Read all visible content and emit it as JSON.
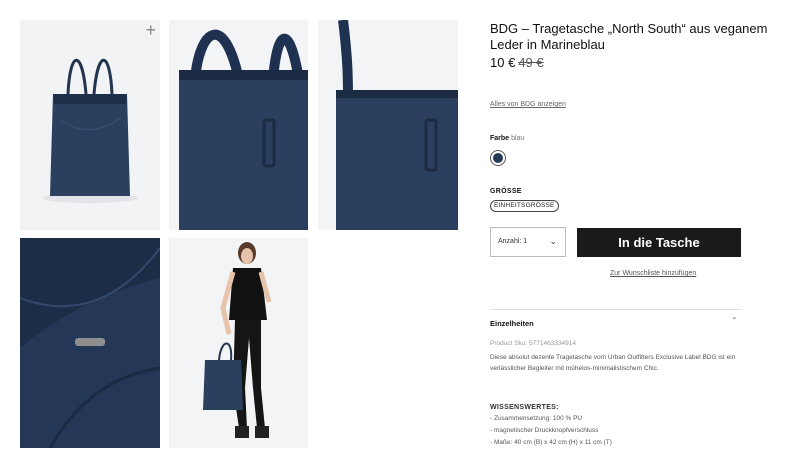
{
  "gallery": {
    "zoom_icon": "+",
    "images": [
      {
        "alt": "tote-bag-front"
      },
      {
        "alt": "tote-bag-handle-closeup"
      },
      {
        "alt": "tote-bag-side-closeup"
      },
      {
        "alt": "tote-bag-interior-closeup"
      },
      {
        "alt": "model-carrying-tote"
      }
    ]
  },
  "product": {
    "title": "BDG – Tragetasche „North South“ aus veganem Leder in Marineblau",
    "price": "10 €",
    "old_price": "49 €",
    "brand_link": "Alles von BDG anzeigen",
    "color_label": "Farbe",
    "color_value": "blau",
    "swatch_color": "#263a58",
    "size_label": "GRÖSSE",
    "size_option": "EINHEITSGRÖSSE",
    "qty_label": "Anzahl: 1",
    "add_to_bag": "In die Tasche",
    "wishlist": "Zur Wunschliste hinzufügen"
  },
  "details": {
    "heading": "Einzelheiten",
    "sku": "Product Sku: 5771463334914",
    "description": "Diese absolut dezente Tragetasche vom Urban Outfitters Exclusive Label BDG ist ein verlässlicher Begleiter mit mühelos-minimalistischem Chic.",
    "features_heading": "WISSENSWERTES:",
    "features": [
      "- Zusammensetzung: 100 % PU",
      "- magnetischer Druckknopfverschluss",
      "- Maße: 40 cm (B) x 42 cm (H) x 11 cm (T)"
    ]
  },
  "colors": {
    "navy": "#263a58",
    "button": "#1a1a1a"
  }
}
